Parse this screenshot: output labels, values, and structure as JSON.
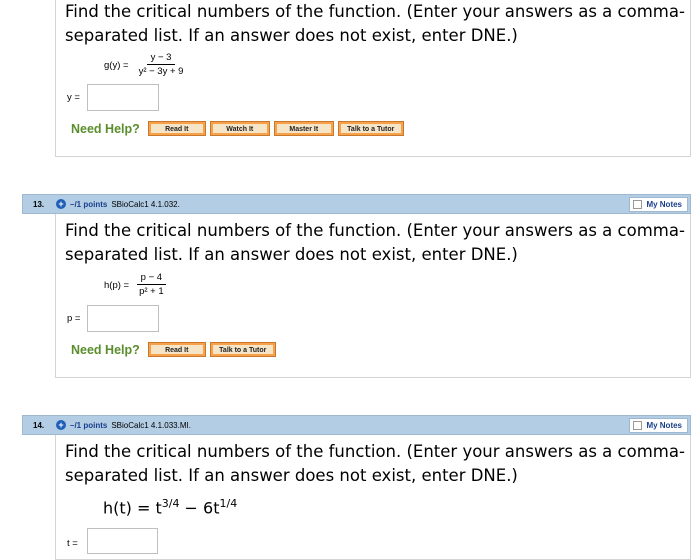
{
  "questions": [
    {
      "prompt_line1": "Find the critical numbers of the function. (Enter your answers as a comma-",
      "prompt_line2": "separated list. If an answer does not exist, enter DNE.)",
      "func_lhs": "g(y) =",
      "numerator": "y − 3",
      "denominator": "y² − 3y + 9",
      "var_label": "y =",
      "answer_value": "",
      "help_label": "Need Help?",
      "help_buttons": [
        "Read It",
        "Watch It",
        "Master It",
        "Talk to a Tutor"
      ]
    },
    {
      "number": "13.",
      "points": "–/1 points",
      "source": "SBioCalc1 4.1.032.",
      "my_notes": "My Notes",
      "prompt_line1": "Find the critical numbers of the function. (Enter your answers as a comma-",
      "prompt_line2": "separated list. If an answer does not exist, enter DNE.)",
      "func_lhs": "h(p) =",
      "numerator": "p − 4",
      "denominator": "p² + 1",
      "var_label": "p =",
      "answer_value": "",
      "help_label": "Need Help?",
      "help_buttons": [
        "Read It",
        "Talk to a Tutor"
      ]
    },
    {
      "number": "14.",
      "points": "–/1 points",
      "source": "SBioCalc1 4.1.033.MI.",
      "my_notes": "My Notes",
      "prompt_line1": "Find the critical numbers of the function. (Enter your answers as a comma-",
      "prompt_line2": "separated list. If an answer does not exist, enter DNE.)",
      "func_text_a": "h(t) = t",
      "func_exp_a": "3/4",
      "func_text_b": " − 6t",
      "func_exp_b": "1/4",
      "var_label": "t =",
      "answer_value": ""
    }
  ],
  "colors": {
    "header_bg": "#b3cde4",
    "help_green": "#5a8d2c",
    "button_orange": "#f7a14a",
    "points_blue": "#1a3f8c"
  }
}
